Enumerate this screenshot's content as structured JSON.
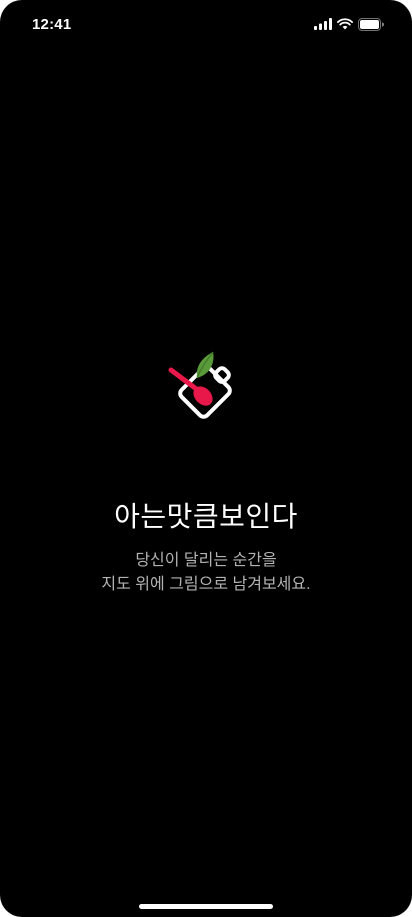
{
  "status_bar": {
    "time": "12:41",
    "icons": [
      "signal-icon",
      "wifi-icon",
      "battery-icon"
    ]
  },
  "splash": {
    "logo_icon": "cutting-board-spoon-leaf-icon",
    "title": "아는맛큼보인다",
    "subtitle_line1": "당신이 달리는 순간을",
    "subtitle_line2": "지도 위에 그림으로 남겨보세요."
  },
  "colors": {
    "background": "#000000",
    "title": "#ffffff",
    "subtitle": "#b3b3b3",
    "spoon": "#e8194a",
    "leaf": "#5a9a3a",
    "board": "#ffffff"
  }
}
